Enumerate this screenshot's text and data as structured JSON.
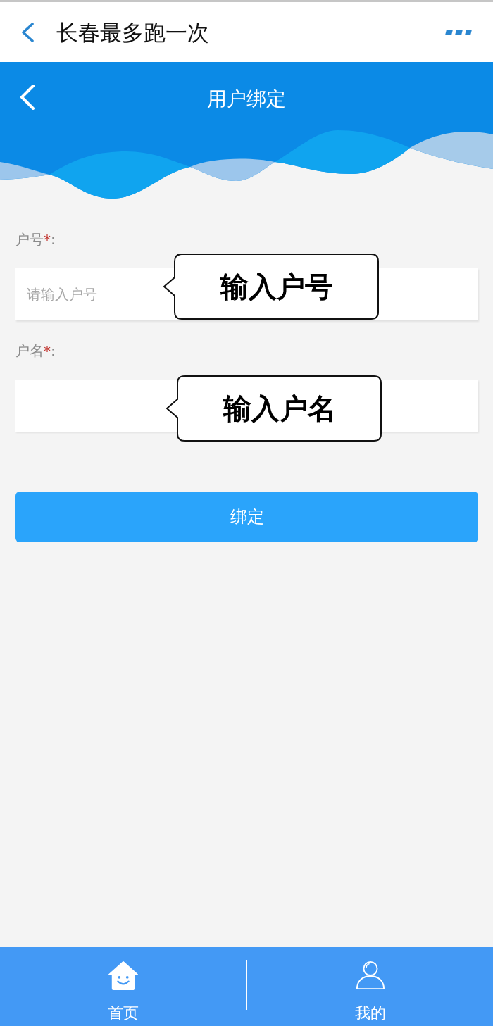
{
  "app_bar": {
    "title": "长春最多跑一次"
  },
  "page_header": {
    "title": "用户绑定"
  },
  "form": {
    "fields": [
      {
        "label": "户号",
        "required_mark": "*",
        "separator": ":",
        "placeholder": "请输入户号",
        "callout": "输入户号"
      },
      {
        "label": "户名",
        "required_mark": "*",
        "separator": ":",
        "callout": "输入户名"
      }
    ],
    "submit_button": "绑定"
  },
  "bottom_nav": [
    {
      "label": "首页",
      "selected": true
    },
    {
      "label": "我的",
      "selected": false
    }
  ]
}
